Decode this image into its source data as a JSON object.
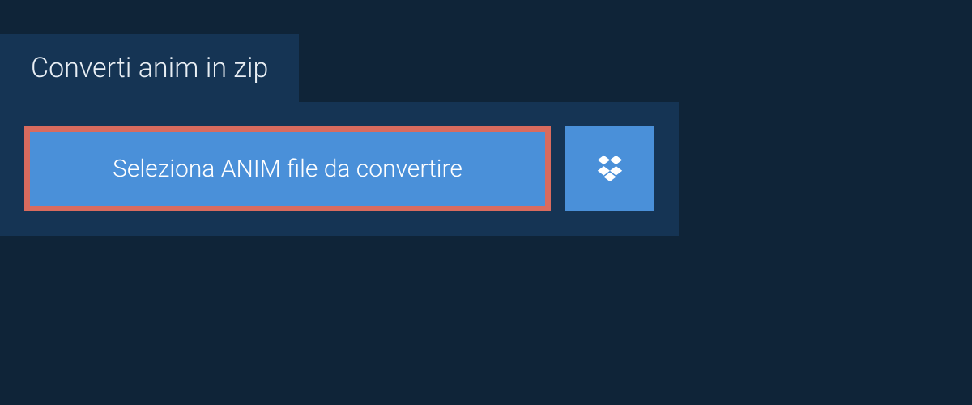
{
  "tab": {
    "label": "Converti anim in zip"
  },
  "actions": {
    "select_file_label": "Seleziona ANIM file da convertire"
  },
  "colors": {
    "bg": "#0f2438",
    "panel": "#153454",
    "button": "#4a90d9",
    "highlight_border": "#d96b5e",
    "text": "#ffffff"
  }
}
